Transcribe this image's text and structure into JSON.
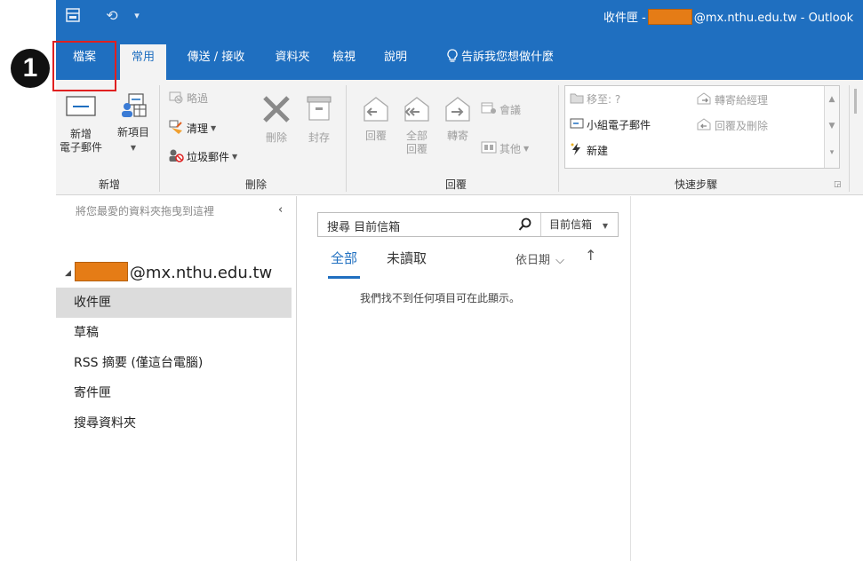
{
  "titlebar": {
    "title_prefix": "收件匣 -",
    "title_suffix": "@mx.nthu.edu.tw - Outlook",
    "icons": [
      "send-receive-all-icon",
      "undo-icon",
      "customize-quick-access-icon"
    ],
    "undo_glyph": "⟲",
    "customize_glyph": "▾"
  },
  "tabs": [
    {
      "label": "檔案"
    },
    {
      "label": "常用"
    },
    {
      "label": "傳送 / 接收"
    },
    {
      "label": "資料夾"
    },
    {
      "label": "檢視"
    },
    {
      "label": "說明"
    },
    {
      "label": "告訴我您想做什麼"
    }
  ],
  "ribbon": {
    "new_group": {
      "label": "新增",
      "new_email": "新增\n電子郵件",
      "new_items": "新項目"
    },
    "delete_group": {
      "label": "刪除",
      "ignore": "略過",
      "cleanup": "清理",
      "junk": "垃圾郵件",
      "delete": "刪除",
      "archive": "封存"
    },
    "respond_group": {
      "label": "回覆",
      "reply": "回覆",
      "reply_all": "全部\n回覆",
      "forward": "轉寄",
      "meeting": "會議",
      "more": "其他"
    },
    "quicksteps_group": {
      "label": "快速步驟",
      "items": [
        "移至: ?",
        "小組電子郵件",
        "新建",
        "轉寄給經理",
        "回覆及刪除"
      ]
    }
  },
  "folder_pane": {
    "favorites_hint": "將您最愛的資料夾拖曳到這裡",
    "collapse_glyph": "‹",
    "account": "@mx.nthu.edu.tw",
    "folders": [
      "收件匣",
      "草稿",
      "RSS 摘要 (僅這台電腦)",
      "寄件匣",
      "搜尋資料夾"
    ],
    "selected_folder": "收件匣"
  },
  "message_list": {
    "search_placeholder": "搜尋 目前信箱",
    "search_scope": "目前信箱",
    "filters": [
      "全部",
      "未讀取"
    ],
    "active_filter": "全部",
    "sort_label": "依日期",
    "sort_direction_glyph": "↑",
    "empty_text": "我們找不到任何項目可在此顯示。"
  },
  "annotation": {
    "step_number": "1",
    "highlight_color": "#e02020"
  },
  "colors": {
    "accent": "#1f6fc0",
    "redaction": "#e57c16"
  }
}
